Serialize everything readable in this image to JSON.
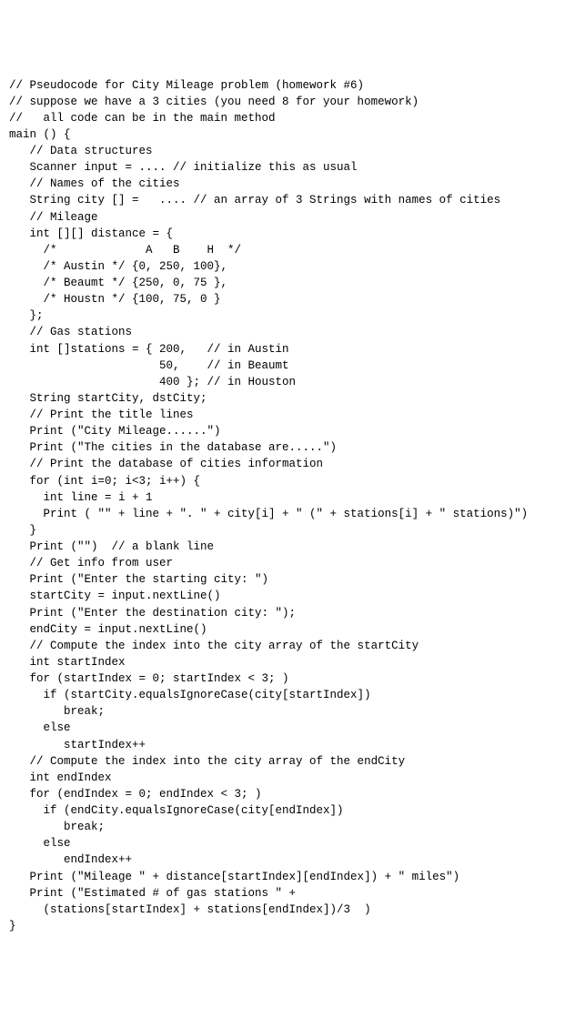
{
  "code": {
    "lines": [
      "// Pseudocode for City Mileage problem (homework #6)",
      "// suppose we have a 3 cities (you need 8 for your homework)",
      "//   all code can be in the main method",
      "main () {",
      "   // Data structures",
      "   Scanner input = .... // initialize this as usual",
      "   // Names of the cities",
      "   String city [] =   .... // an array of 3 Strings with names of cities",
      "   // Mileage",
      "   int [][] distance = {",
      "     /*             A   B    H  */",
      "     /* Austin */ {0, 250, 100},",
      "     /* Beaumt */ {250, 0, 75 },",
      "     /* Houstn */ {100, 75, 0 }",
      "   };",
      "   // Gas stations",
      "   int []stations = { 200,   // in Austin",
      "                      50,    // in Beaumt",
      "                      400 }; // in Houston",
      "",
      "   String startCity, dstCity;",
      "",
      "   // Print the title lines",
      "   Print (\"City Mileage......\")",
      "   Print (\"The cities in the database are.....\")",
      "   // Print the database of cities information",
      "   for (int i=0; i<3; i++) {",
      "     int line = i + 1",
      "     Print ( \"\" + line + \". \" + city[i] + \" (\" + stations[i] + \" stations)\")",
      "   }",
      "   Print (\"\")  // a blank line",
      "",
      "   // Get info from user",
      "   Print (\"Enter the starting city: \")",
      "   startCity = input.nextLine()",
      "   Print (\"Enter the destination city: \");",
      "   endCity = input.nextLine()",
      "",
      "   // Compute the index into the city array of the startCity",
      "   int startIndex",
      "   for (startIndex = 0; startIndex < 3; )",
      "     if (startCity.equalsIgnoreCase(city[startIndex])",
      "        break;",
      "     else",
      "        startIndex++",
      "",
      "   // Compute the index into the city array of the endCity",
      "   int endIndex",
      "   for (endIndex = 0; endIndex < 3; )",
      "     if (endCity.equalsIgnoreCase(city[endIndex])",
      "        break;",
      "     else",
      "        endIndex++",
      "",
      "   Print (\"Mileage \" + distance[startIndex][endIndex]) + \" miles\")",
      "   Print (\"Estimated # of gas stations \" +",
      "     (stations[startIndex] + stations[endIndex])/3  )",
      "",
      "}"
    ]
  }
}
